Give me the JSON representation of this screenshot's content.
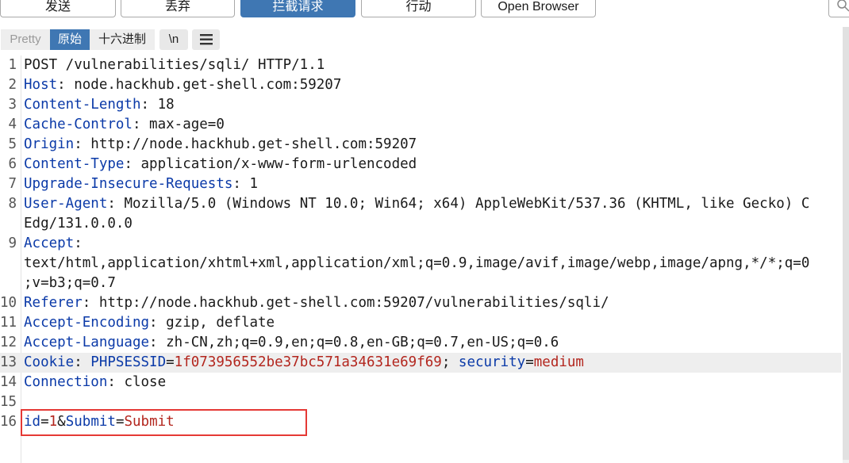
{
  "toolbar": {
    "send": "发送",
    "drop": "丢弃",
    "intercept": "拦截请求",
    "action": "行动",
    "open_browser": "Open Browser"
  },
  "view_tabs": {
    "pretty": "Pretty",
    "raw": "原始",
    "hex": "十六进制",
    "newline": "\\n",
    "menu_icon": "hamburger-menu-icon"
  },
  "colors": {
    "accent": "#3f77b3",
    "header_key": "#0b3aa8",
    "param_value": "#b3261e",
    "highlight_box": "#e53935"
  },
  "request": {
    "lines": [
      {
        "num": "1",
        "text": "POST /vulnerabilities/sqli/ HTTP/1.1"
      },
      {
        "num": "2",
        "key": "Host",
        "sep": ": ",
        "val": "node.hackhub.get-shell.com:59207"
      },
      {
        "num": "3",
        "key": "Content-Length",
        "sep": ": ",
        "val": "18"
      },
      {
        "num": "4",
        "key": "Cache-Control",
        "sep": ": ",
        "val": "max-age=0"
      },
      {
        "num": "5",
        "key": "Origin",
        "sep": ": ",
        "val": "http://node.hackhub.get-shell.com:59207"
      },
      {
        "num": "6",
        "key": "Content-Type",
        "sep": ": ",
        "val": "application/x-www-form-urlencoded"
      },
      {
        "num": "7",
        "key": "Upgrade-Insecure-Requests",
        "sep": ": ",
        "val": "1"
      },
      {
        "num": "8",
        "key": "User-Agent",
        "sep": ": ",
        "val": "Mozilla/5.0 (Windows NT 10.0; Win64; x64) AppleWebKit/537.36 (KHTML, like Gecko) C",
        "cont": [
          "Edg/131.0.0.0"
        ]
      },
      {
        "num": "9",
        "key": "Accept",
        "sep": ":",
        "val": "",
        "cont": [
          "text/html,application/xhtml+xml,application/xml;q=0.9,image/avif,image/webp,image/apng,*/*;q=0",
          ";v=b3;q=0.7"
        ]
      },
      {
        "num": "10",
        "key": "Referer",
        "sep": ": ",
        "val": "http://node.hackhub.get-shell.com:59207/vulnerabilities/sqli/"
      },
      {
        "num": "11",
        "key": "Accept-Encoding",
        "sep": ": ",
        "val": "gzip, deflate"
      },
      {
        "num": "12",
        "key": "Accept-Language",
        "sep": ": ",
        "val": "zh-CN,zh;q=0.9,en;q=0.8,en-GB;q=0.7,en-US;q=0.6"
      },
      {
        "num": "13",
        "key": "Cookie",
        "sep": ": ",
        "cookie": [
          {
            "name": "PHPSESSID",
            "value": "1f073956552be37bc571a34631e69f69"
          },
          {
            "name": "security",
            "value": "medium"
          }
        ]
      },
      {
        "num": "14",
        "key": "Connection",
        "sep": ": ",
        "val": "close"
      },
      {
        "num": "15",
        "text": ""
      },
      {
        "num": "16",
        "params": [
          {
            "name": "id",
            "value": "1"
          },
          {
            "name": "Submit",
            "value": "Submit"
          }
        ]
      }
    ]
  }
}
